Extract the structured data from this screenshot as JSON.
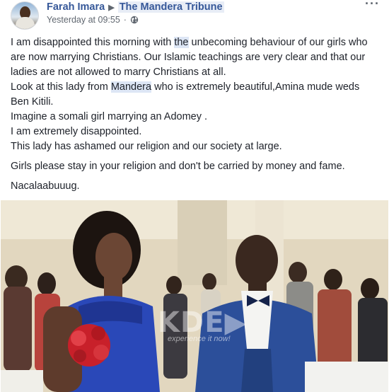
{
  "post": {
    "author": "Farah Imara",
    "page": "The Mandera Tribune",
    "timestamp": "Yesterday at 09:55",
    "privacy_icon": "globe-icon",
    "menu_icon": "more-options-icon",
    "paragraphs": [
      [
        "I am disappointed this morning with ",
        "the",
        " unbecoming behaviour of our girls who are now marrying Christians. Our Islamic teachings are very clear and that our ladies are not allowed to marry Christians at all."
      ],
      [
        "Look at this lady from ",
        "Mandera",
        " who is extremely beautiful,Amina mude weds Ben Kitili."
      ],
      [
        "Imagine a somali girl marrying an Adomey ."
      ],
      [
        "I am extremely disappointed."
      ],
      [
        "This lady has ashamed our religion and our society at large."
      ],
      [
        "Girls please stay in your religion and don't be carried by money and fame."
      ],
      [
        "Nacalaabuuug."
      ]
    ],
    "photo": {
      "watermark": "KDE▶",
      "watermark_sub": "experience it now!"
    }
  },
  "colors": {
    "link": "#365899",
    "text": "#1d2129",
    "meta": "#606770",
    "highlight": "#dde6f5"
  }
}
